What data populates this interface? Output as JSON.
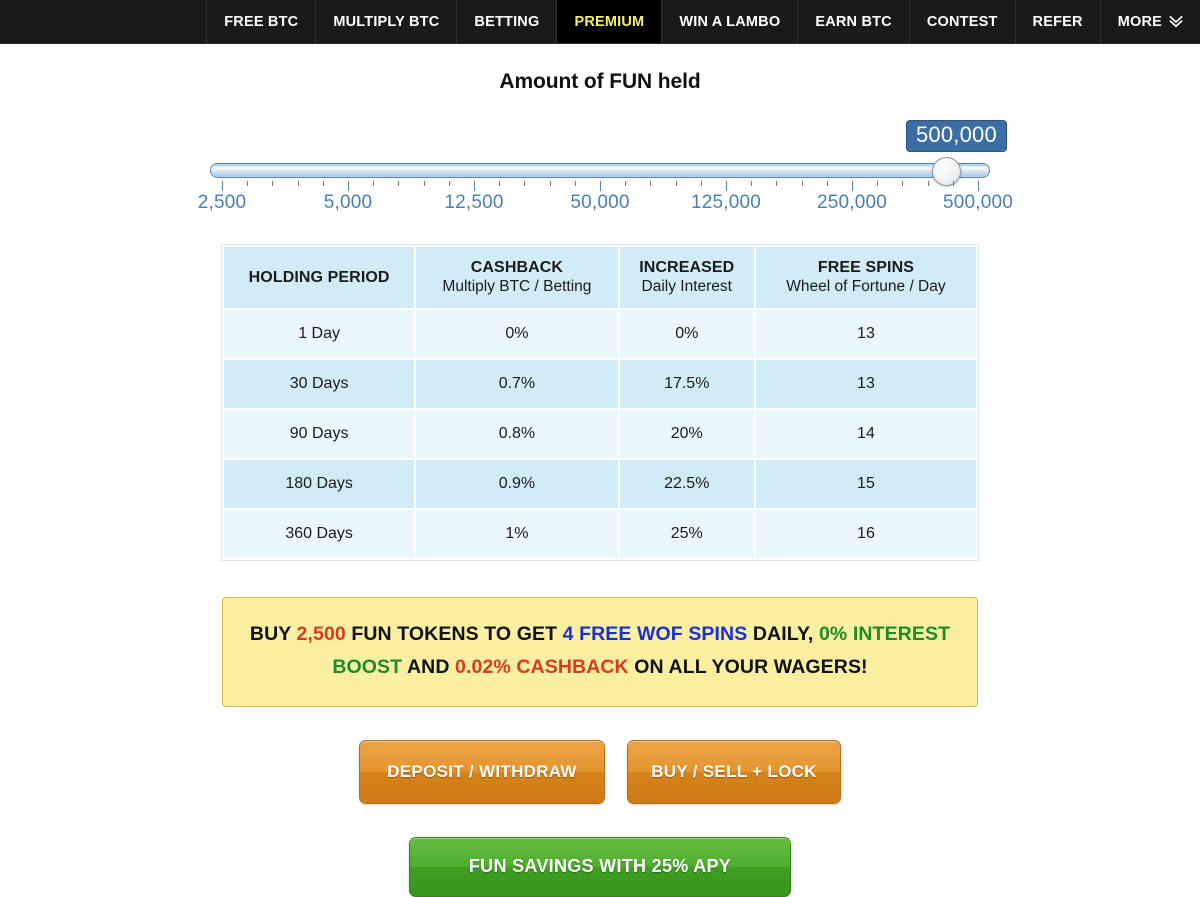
{
  "nav": {
    "items": [
      {
        "label": "FREE BTC",
        "active": false,
        "icon": null
      },
      {
        "label": "MULTIPLY BTC",
        "active": false,
        "icon": null
      },
      {
        "label": "BETTING",
        "active": false,
        "icon": null
      },
      {
        "label": "PREMIUM",
        "active": true,
        "icon": null
      },
      {
        "label": "WIN A LAMBO",
        "active": false,
        "icon": null
      },
      {
        "label": "EARN BTC",
        "active": false,
        "icon": null
      },
      {
        "label": "CONTEST",
        "active": false,
        "icon": null
      },
      {
        "label": "REFER",
        "active": false,
        "icon": null
      },
      {
        "label": "MORE",
        "active": false,
        "icon": "chevron-double-down-icon",
        "icon_glyph": "»"
      }
    ],
    "active_color": "#f5f065",
    "background": "#1a1a1a"
  },
  "page": {
    "title": "Amount of FUN held"
  },
  "slider": {
    "value_label": "500,000",
    "value_index": 7,
    "tick_labels": [
      "2,500",
      "5,000",
      "12,500",
      "50,000",
      "125,000",
      "250,000",
      "500,000"
    ],
    "minor_ticks_per_segment": 4,
    "track_color": "#a8c8e4",
    "tooltip_color": "#3a6ea5",
    "label_color": "#4a7fb5"
  },
  "table": {
    "headers": [
      {
        "main": "HOLDING PERIOD",
        "sub": ""
      },
      {
        "main": "CASHBACK",
        "sub": "Multiply BTC / Betting"
      },
      {
        "main": "INCREASED",
        "sub": "Daily Interest"
      },
      {
        "main": "FREE SPINS",
        "sub": "Wheel of Fortune / Day"
      }
    ],
    "rows": [
      {
        "period": "1 Day",
        "cashback": "0%",
        "interest": "0%",
        "spins": "13"
      },
      {
        "period": "30 Days",
        "cashback": "0.7%",
        "interest": "17.5%",
        "spins": "13"
      },
      {
        "period": "90 Days",
        "cashback": "0.8%",
        "interest": "20%",
        "spins": "14"
      },
      {
        "period": "180 Days",
        "cashback": "0.9%",
        "interest": "22.5%",
        "spins": "15"
      },
      {
        "period": "360 Days",
        "cashback": "1%",
        "interest": "25%",
        "spins": "16"
      }
    ],
    "header_bg": "#d2ecf7",
    "row_odd_bg": "#eaf8fd",
    "row_even_bg": "#d2ecf7"
  },
  "banner": {
    "segments": [
      {
        "text": "BUY ",
        "color": "black"
      },
      {
        "text": "2,500",
        "color": "red"
      },
      {
        "text": " FUN TOKENS TO GET ",
        "color": "black"
      },
      {
        "text": "4 FREE WOF SPINS",
        "color": "blue"
      },
      {
        "text": " DAILY, ",
        "color": "black"
      },
      {
        "text": "0% INTEREST BOOST",
        "color": "green"
      },
      {
        "text": " AND ",
        "color": "black"
      },
      {
        "text": "0.02% CASHBACK",
        "color": "red"
      },
      {
        "text": " ON ALL YOUR WAGERS!",
        "color": "black"
      }
    ],
    "background": "#faeea0",
    "border": "#d9b949",
    "red": "#d93a20",
    "blue": "#1a2fd8",
    "green": "#1f8a2a"
  },
  "buttons": {
    "deposit_withdraw": "DEPOSIT / WITHDRAW",
    "buy_sell_lock": "BUY / SELL + LOCK",
    "fun_savings": "FUN SAVINGS WITH 25% APY",
    "orange": "#e4952f",
    "green": "#4fae2f"
  }
}
